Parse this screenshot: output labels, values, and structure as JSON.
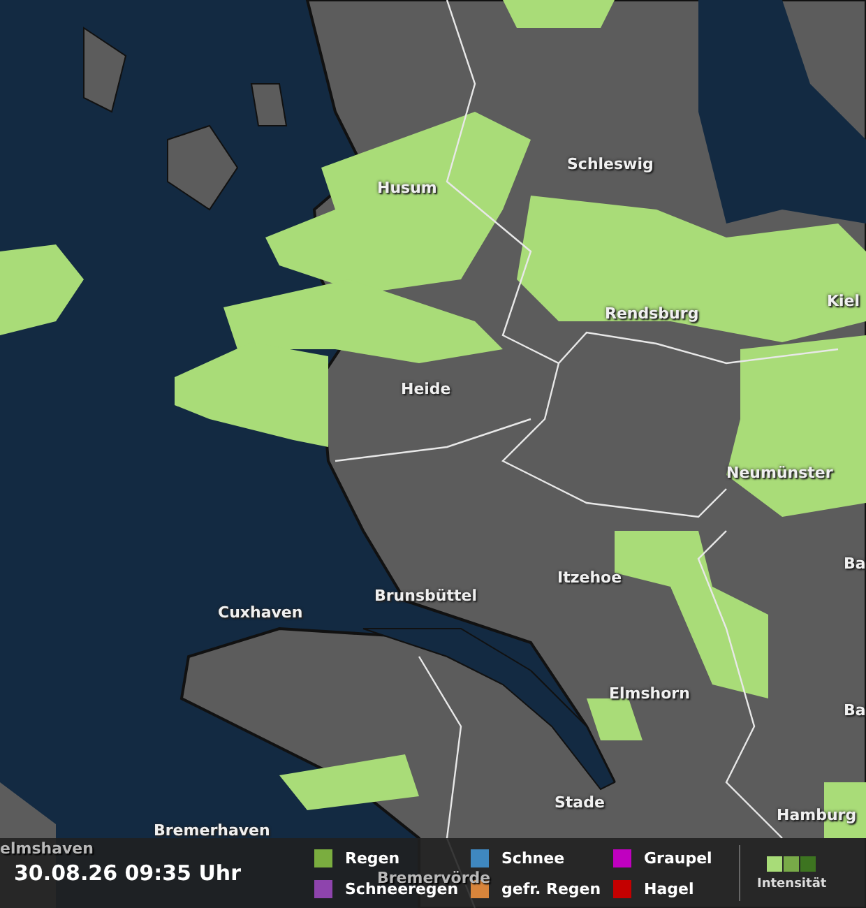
{
  "map": {
    "places": [
      {
        "name": "Husum"
      },
      {
        "name": "Schleswig"
      },
      {
        "name": "Kiel"
      },
      {
        "name": "Rendsburg"
      },
      {
        "name": "Heide"
      },
      {
        "name": "Neumünster"
      },
      {
        "name": "Ba"
      },
      {
        "name": "Itzehoe"
      },
      {
        "name": "Brunsbüttel"
      },
      {
        "name": "Cuxhaven"
      },
      {
        "name": "Ba"
      },
      {
        "name": "Elmshorn"
      },
      {
        "name": "Stade"
      },
      {
        "name": "Hamburg"
      },
      {
        "name": "Bremerhaven"
      },
      {
        "name": "elmshaven"
      },
      {
        "name": "Bremervörde"
      }
    ]
  },
  "legend": {
    "timestamp": "30.08.26 09:35 Uhr",
    "items": [
      {
        "label": "Regen",
        "color": "#7aad3f"
      },
      {
        "label": "Schneeregen",
        "color": "#8e44ad"
      },
      {
        "label": "Schnee",
        "color": "#3f88c0"
      },
      {
        "label": "gefr. Regen",
        "color": "#d9853b"
      },
      {
        "label": "Graupel",
        "color": "#c000c0"
      },
      {
        "label": "Hagel",
        "color": "#c40000"
      }
    ],
    "intensity": {
      "label": "Intensität",
      "steps": [
        {
          "color": "#a8dc78"
        },
        {
          "color": "#78aa48"
        },
        {
          "color": "#3d7420"
        }
      ]
    }
  }
}
